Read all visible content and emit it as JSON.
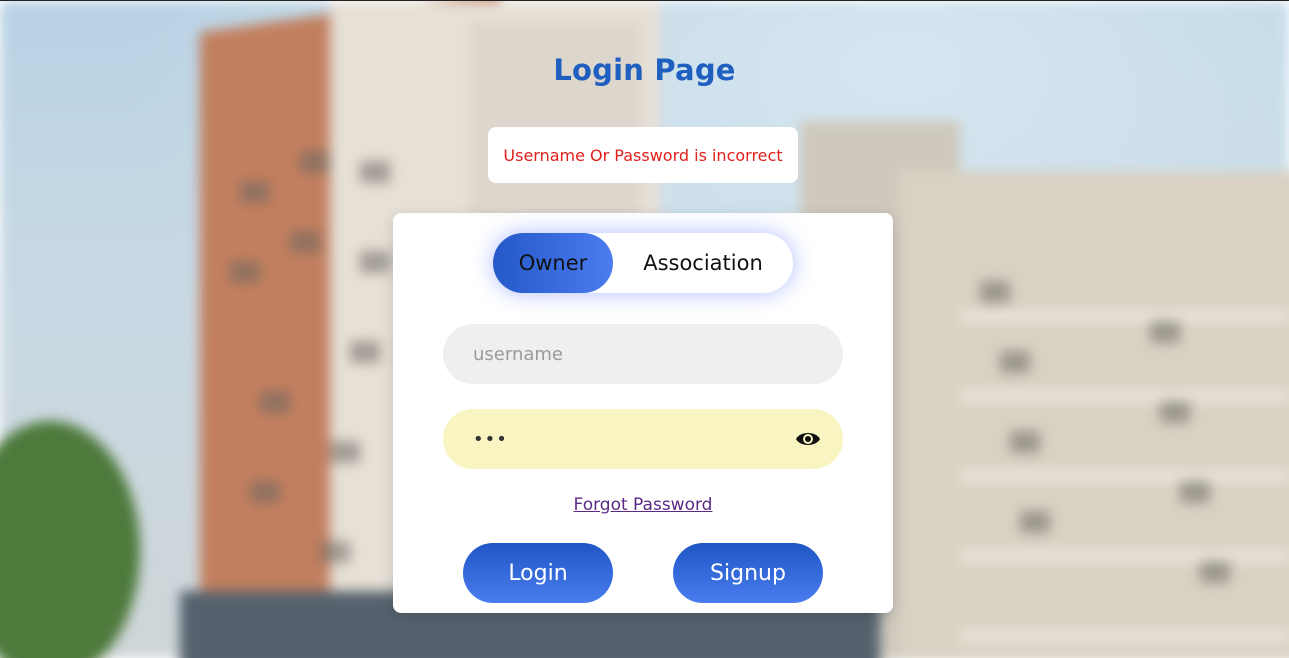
{
  "page": {
    "title": "Login Page"
  },
  "alert": {
    "message": "Username Or Password is incorrect",
    "color": "#e0201b"
  },
  "role_toggle": {
    "options": [
      "Owner",
      "Association"
    ],
    "selected": "Owner"
  },
  "form": {
    "username_placeholder": "username",
    "username_value": "",
    "password_value": "•••",
    "password_icon": "eye-icon"
  },
  "links": {
    "forgot_password": "Forgot Password"
  },
  "buttons": {
    "login": "Login",
    "signup": "Signup"
  },
  "colors": {
    "title": "#1e5fc0",
    "button_gradient_start": "#1f56c4",
    "button_gradient_end": "#4a7df0",
    "password_field_bg": "#f8f5c2",
    "username_field_bg": "#efefef"
  }
}
